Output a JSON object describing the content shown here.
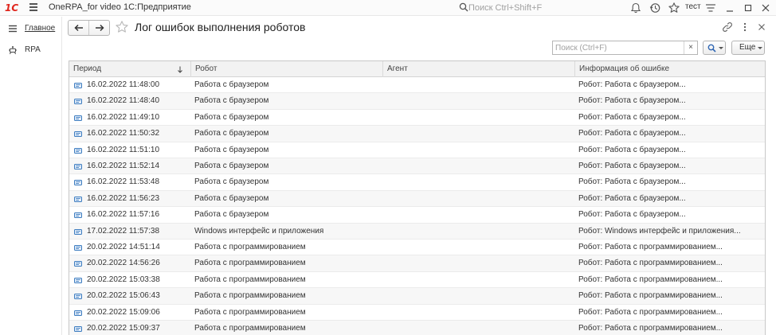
{
  "titlebar": {
    "logo": "1С",
    "app_title": "OneRPA_for video 1С:Предприятие",
    "search_placeholder": "Поиск Ctrl+Shift+F",
    "user": "тест"
  },
  "sidebar": {
    "items": [
      {
        "label": "Главное",
        "icon": "hamburger-icon"
      },
      {
        "label": "RPA",
        "icon": "robot-icon"
      }
    ]
  },
  "form": {
    "title": "Лог ошибок выполнения роботов",
    "search_placeholder": "Поиск (Ctrl+F)",
    "clear_label": "×",
    "more_label": "Еще"
  },
  "table": {
    "columns": [
      {
        "label": "Период",
        "sorted": "descending"
      },
      {
        "label": "Робот"
      },
      {
        "label": "Агент"
      },
      {
        "label": "Информация об ошибке"
      }
    ],
    "rows": [
      {
        "period": "16.02.2022 11:48:00",
        "robot": "Работа с браузером",
        "agent": "",
        "info": "Робот: Работа с браузером..."
      },
      {
        "period": "16.02.2022 11:48:40",
        "robot": "Работа с браузером",
        "agent": "",
        "info": "Робот: Работа с браузером..."
      },
      {
        "period": "16.02.2022 11:49:10",
        "robot": "Работа с браузером",
        "agent": "",
        "info": "Робот: Работа с браузером..."
      },
      {
        "period": "16.02.2022 11:50:32",
        "robot": "Работа с браузером",
        "agent": "",
        "info": "Робот: Работа с браузером..."
      },
      {
        "period": "16.02.2022 11:51:10",
        "robot": "Работа с браузером",
        "agent": "",
        "info": "Робот: Работа с браузером..."
      },
      {
        "period": "16.02.2022 11:52:14",
        "robot": "Работа с браузером",
        "agent": "",
        "info": "Робот: Работа с браузером..."
      },
      {
        "period": "16.02.2022 11:53:48",
        "robot": "Работа с браузером",
        "agent": "",
        "info": "Робот: Работа с браузером..."
      },
      {
        "period": "16.02.2022 11:56:23",
        "robot": "Работа с браузером",
        "agent": "",
        "info": "Робот: Работа с браузером..."
      },
      {
        "period": "16.02.2022 11:57:16",
        "robot": "Работа с браузером",
        "agent": "",
        "info": "Робот: Работа с браузером..."
      },
      {
        "period": "17.02.2022 11:57:38",
        "robot": "Windows интерфейс и приложения",
        "agent": "",
        "info": "Робот: Windows интерфейс и приложения..."
      },
      {
        "period": "20.02.2022 14:51:14",
        "robot": "Работа с программированием",
        "agent": "",
        "info": "Робот: Работа с программированием..."
      },
      {
        "period": "20.02.2022 14:56:26",
        "robot": "Работа с программированием",
        "agent": "",
        "info": "Робот: Работа с программированием..."
      },
      {
        "period": "20.02.2022 15:03:38",
        "robot": "Работа с программированием",
        "agent": "",
        "info": "Робот: Работа с программированием..."
      },
      {
        "period": "20.02.2022 15:06:43",
        "robot": "Работа с программированием",
        "agent": "",
        "info": "Робот: Работа с программированием..."
      },
      {
        "period": "20.02.2022 15:09:06",
        "robot": "Работа с программированием",
        "agent": "",
        "info": "Робот: Работа с программированием..."
      },
      {
        "period": "20.02.2022 15:09:37",
        "robot": "Работа с программированием",
        "agent": "",
        "info": "Робот: Работа с программированием..."
      }
    ]
  },
  "colors": {
    "logo_red": "#e0261d",
    "row_alt": "#f7f7f7",
    "header_bg": "#f2f2f2",
    "row_icon": "#3b7bbf"
  }
}
